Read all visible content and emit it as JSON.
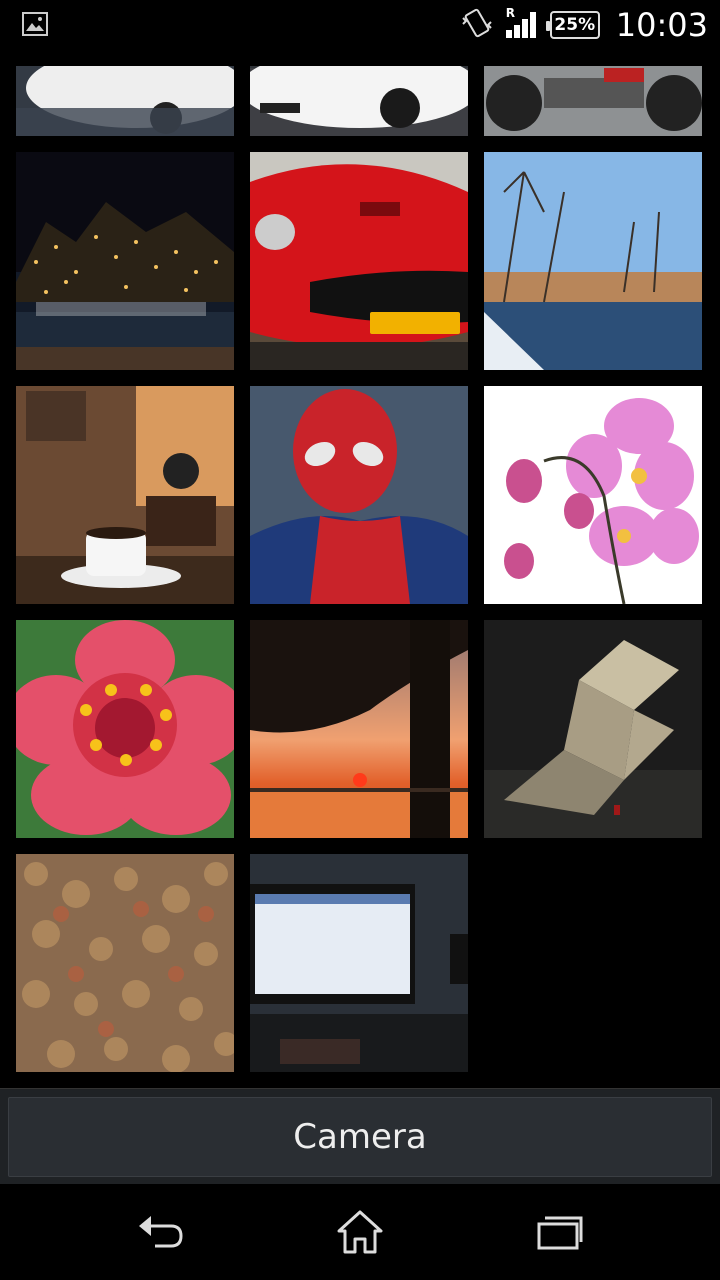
{
  "status_bar": {
    "notification_icon": "image-icon",
    "vibrate_icon": "vibrate-icon",
    "roaming_indicator": "R",
    "signal_icon": "signal-icon",
    "battery_percent": "25%",
    "time": "10:03"
  },
  "gallery": {
    "tiles": [
      {
        "name": "white-car-partial"
      },
      {
        "name": "white-mercedes-partial"
      },
      {
        "name": "motorcycle-partial"
      },
      {
        "name": "night-harbor-city"
      },
      {
        "name": "red-ferrari"
      },
      {
        "name": "winter-river-trees"
      },
      {
        "name": "coffee-cup-grinder"
      },
      {
        "name": "spiderman"
      },
      {
        "name": "pink-orchids"
      },
      {
        "name": "red-zinnia-flower"
      },
      {
        "name": "sunset-tree-silhouette"
      },
      {
        "name": "origami-bird-rain"
      },
      {
        "name": "leaf-carpet-texture"
      },
      {
        "name": "computer-monitor-desk"
      }
    ]
  },
  "camera_button": {
    "label": "Camera"
  },
  "nav": {
    "back_icon": "back-icon",
    "home_icon": "home-icon",
    "recents_icon": "recents-icon"
  }
}
